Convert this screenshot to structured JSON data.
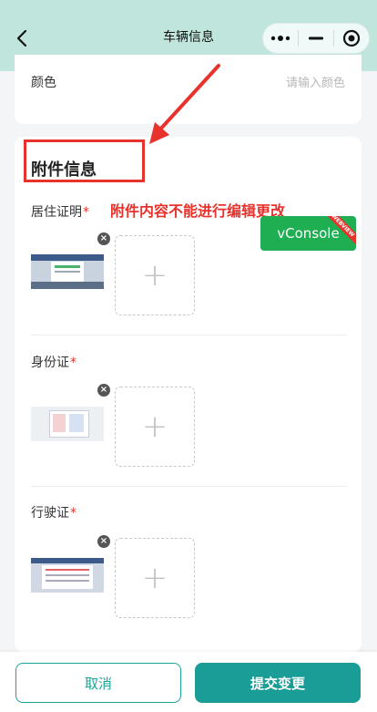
{
  "navbar": {
    "title": "车辆信息",
    "back_icon": "chevron-left-icon",
    "menu_icon": "more-dots-icon",
    "minimize_icon": "minimize-icon",
    "close_icon": "record-target-icon"
  },
  "color_field": {
    "label": "颜色",
    "placeholder": "请输入颜色"
  },
  "attachments": {
    "title": "附件信息",
    "note": "附件内容不能进行编辑更改",
    "fields": [
      {
        "label": "居住证明",
        "required_mark": "*",
        "upload_icon": "+"
      },
      {
        "label": "身份证",
        "required_mark": "*",
        "upload_icon": "+"
      },
      {
        "label": "行驶证",
        "required_mark": "*",
        "upload_icon": "+"
      }
    ],
    "delete_icon": "×"
  },
  "vconsole": {
    "label": "vConsole",
    "ribbon": "WEBVIEW"
  },
  "footer": {
    "cancel_label": "取消",
    "submit_label": "提交变更"
  },
  "colors": {
    "navbar_bg": "#bfe5dd",
    "accent": "#1a9d96",
    "annotation_red": "#e8322c",
    "vconsole_green": "#1fae52"
  }
}
